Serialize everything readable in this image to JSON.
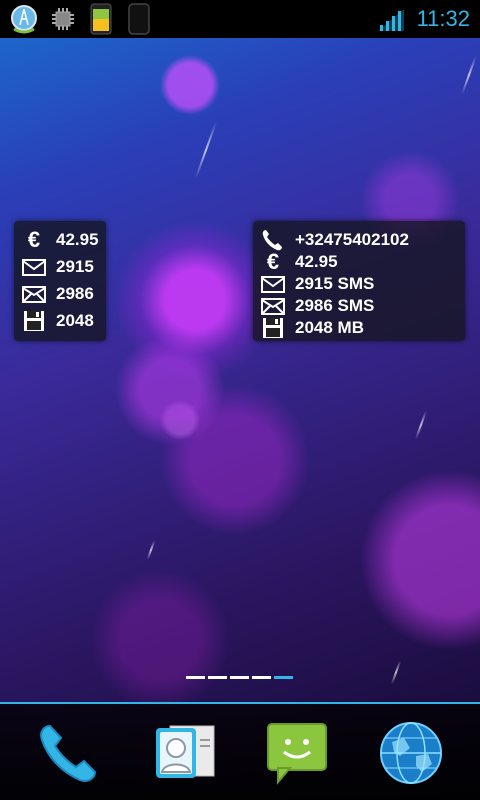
{
  "status_bar": {
    "time": "11:32",
    "icons": [
      "tower-app-icon",
      "chip-icon",
      "battery-widget-icon",
      "phone-outline-icon",
      "signal-icon"
    ]
  },
  "widget_small": {
    "rows": [
      {
        "icon": "euro-icon",
        "value": "42.95"
      },
      {
        "icon": "envelope-open-icon",
        "value": "2915"
      },
      {
        "icon": "envelope-closed-icon",
        "value": "2986"
      },
      {
        "icon": "floppy-disk-icon",
        "value": "2048"
      }
    ]
  },
  "widget_large": {
    "rows": [
      {
        "icon": "phone-icon",
        "value": "+32475402102"
      },
      {
        "icon": "euro-icon",
        "value": "42.95"
      },
      {
        "icon": "envelope-open-icon",
        "value": "2915 SMS"
      },
      {
        "icon": "envelope-closed-icon",
        "value": "2986 SMS"
      },
      {
        "icon": "floppy-disk-icon",
        "value": "2048 MB"
      }
    ]
  },
  "euro_symbol": "€",
  "pager": {
    "pages": 5,
    "active_index": 4
  },
  "dock": {
    "items": [
      "phone-app-icon",
      "contacts-app-icon",
      "messaging-app-icon",
      "browser-app-icon"
    ]
  },
  "colors": {
    "accent": "#33b5e5"
  }
}
